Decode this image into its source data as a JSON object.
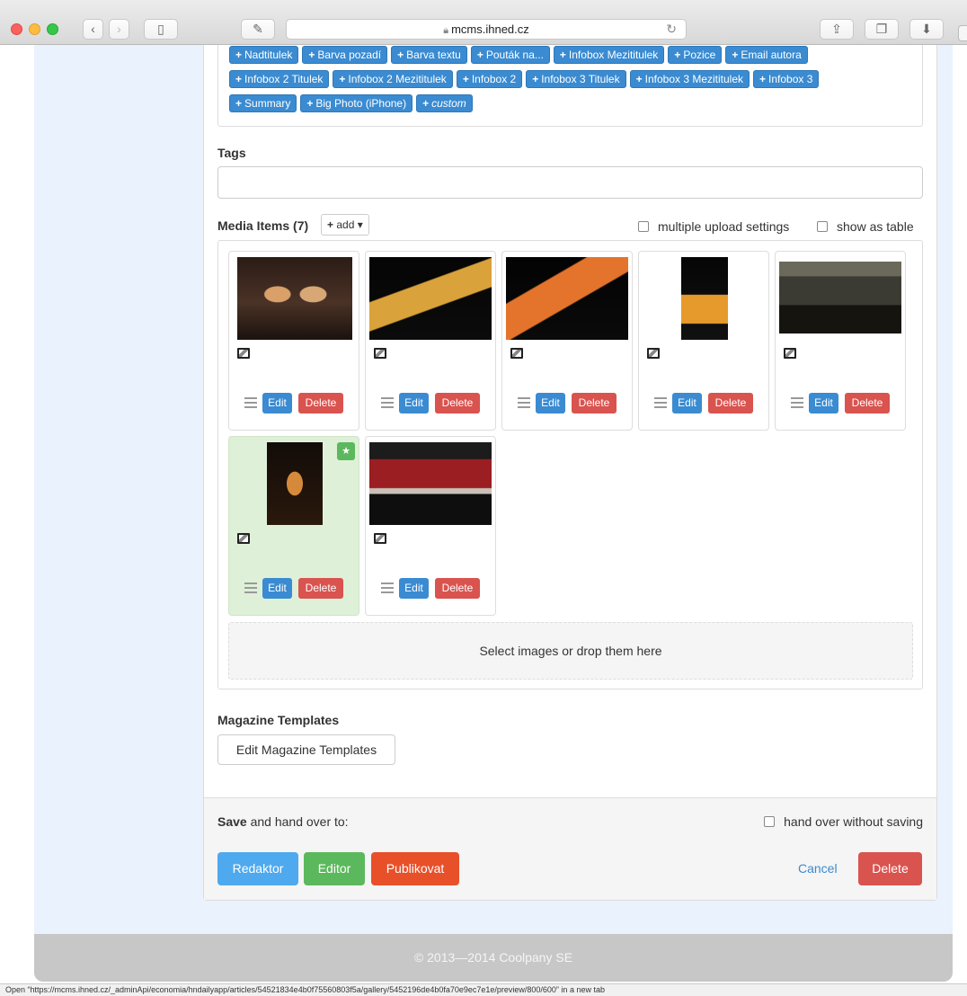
{
  "browser": {
    "address": "mcms.ihned.cz",
    "icons": {
      "back": "chevron-left-icon",
      "forward": "chevron-right-icon",
      "sidebar": "sidebar-icon",
      "compose": "compose-icon",
      "lock": "lock-icon",
      "reload": "reload-icon",
      "share": "share-icon",
      "tabs": "tabs-icon",
      "downloads": "download-icon"
    }
  },
  "field_templates": {
    "row1": [
      "Nadtitulek",
      "Barva pozadí",
      "Barva textu",
      "Pouták na...",
      "Infobox Mezititulek",
      "Pozice",
      "Email autora"
    ],
    "row2": [
      "Infobox 2 Titulek",
      "Infobox 2 Mezititulek",
      "Infobox 2",
      "Infobox 3 Titulek",
      "Infobox 3 Mezititulek",
      "Infobox 3"
    ],
    "row3": [
      "Summary",
      "Big Photo (iPhone)",
      "custom"
    ]
  },
  "tags": {
    "label": "Tags",
    "value": ""
  },
  "media": {
    "label": "Media Items (7)",
    "add_label": "add",
    "multiple_upload": "multiple upload settings",
    "show_as_table": "show as table",
    "items": [
      {
        "edit": "Edit",
        "delete": "Delete",
        "featured": false
      },
      {
        "edit": "Edit",
        "delete": "Delete",
        "featured": false
      },
      {
        "edit": "Edit",
        "delete": "Delete",
        "featured": false
      },
      {
        "edit": "Edit",
        "delete": "Delete",
        "featured": false
      },
      {
        "edit": "Edit",
        "delete": "Delete",
        "featured": false
      },
      {
        "edit": "Edit",
        "delete": "Delete",
        "featured": true
      },
      {
        "edit": "Edit",
        "delete": "Delete",
        "featured": false
      }
    ],
    "dropzone": "Select images or drop them here"
  },
  "magazine": {
    "label": "Magazine Templates",
    "button": "Edit Magazine Templates"
  },
  "footer": {
    "save_bold": "Save",
    "save_rest": " and hand over to:",
    "hand_over": "hand over without saving",
    "redaktor": "Redaktor",
    "editor": "Editor",
    "publikovat": "Publikovat",
    "cancel": "Cancel",
    "delete": "Delete"
  },
  "copyright": "© 2013—2014 Coolpany SE",
  "status": "Open “https://mcms.ihned.cz/_adminApi/economia/hndailyapp/articles/54521834e4b0f75560803f5a/gallery/5452196de4b0fa70e9ec7e1e/preview/800/600” in a new tab",
  "colors": {
    "primary": "#3a8bd1",
    "danger": "#d9534f",
    "success": "#5cb85c",
    "info": "#4fa9ee",
    "publish": "#e8502a"
  }
}
